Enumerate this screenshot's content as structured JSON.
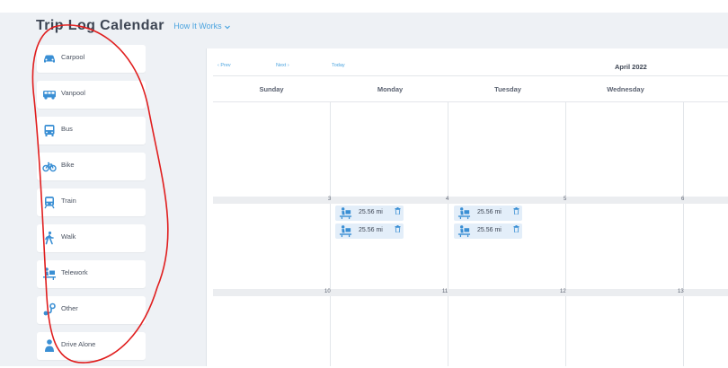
{
  "app": {
    "title": "Trip Log Calendar",
    "how_it_works": "How It Works"
  },
  "modes": [
    {
      "label": "Carpool",
      "icon": "car-icon"
    },
    {
      "label": "Vanpool",
      "icon": "van-icon"
    },
    {
      "label": "Bus",
      "icon": "bus-icon"
    },
    {
      "label": "Bike",
      "icon": "bike-icon"
    },
    {
      "label": "Train",
      "icon": "train-icon"
    },
    {
      "label": "Walk",
      "icon": "walk-icon"
    },
    {
      "label": "Telework",
      "icon": "telework-icon"
    },
    {
      "label": "Other",
      "icon": "other-icon"
    },
    {
      "label": "Drive Alone",
      "icon": "person-icon"
    }
  ],
  "calendar": {
    "nav": {
      "prev": "‹ Prev",
      "next": "Next ›",
      "today": "Today"
    },
    "month": "April 2022",
    "weekdays": [
      "Sunday",
      "Monday",
      "Tuesday",
      "Wednesday"
    ],
    "week_numbers": [
      [
        "3",
        "4",
        "5",
        "6"
      ],
      [
        "10",
        "11",
        "12",
        "13"
      ]
    ],
    "trips": {
      "monday": [
        "25.56 mi",
        "25.56 mi"
      ],
      "tuesday": [
        "25.56 mi",
        "25.56 mi"
      ]
    }
  },
  "colors": {
    "accent": "#4aa3df",
    "icon_blue": "#3a8fd4",
    "annotation_red": "#e01e1e",
    "background": "#eef1f5"
  }
}
